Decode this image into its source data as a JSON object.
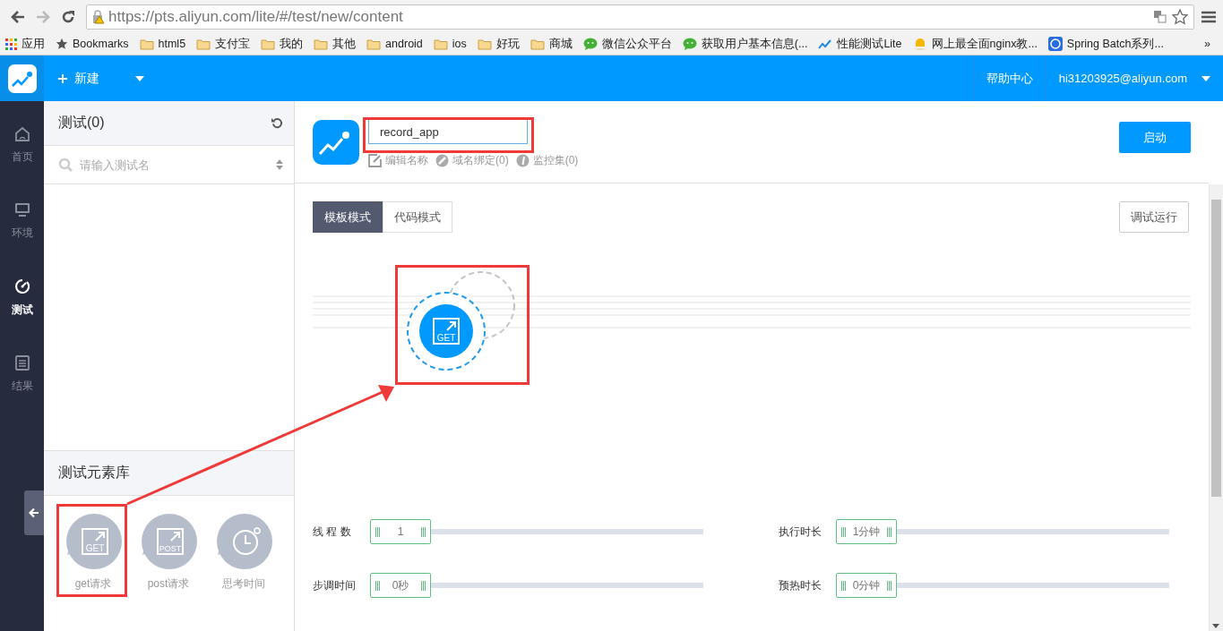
{
  "browser": {
    "url": "https://pts.aliyun.com/lite/#/test/new/content",
    "bookmarks": [
      {
        "kind": "apps",
        "label": "应用"
      },
      {
        "kind": "star",
        "label": "Bookmarks"
      },
      {
        "kind": "folder",
        "label": "html5"
      },
      {
        "kind": "folder",
        "label": "支付宝"
      },
      {
        "kind": "folder",
        "label": "我的"
      },
      {
        "kind": "folder",
        "label": "其他"
      },
      {
        "kind": "folder",
        "label": "android"
      },
      {
        "kind": "folder",
        "label": "ios"
      },
      {
        "kind": "folder",
        "label": "好玩"
      },
      {
        "kind": "folder",
        "label": "商城"
      },
      {
        "kind": "chat",
        "label": "微信公众平台"
      },
      {
        "kind": "chat",
        "label": "获取用户基本信息(..."
      },
      {
        "kind": "chart",
        "label": "性能测试Lite"
      },
      {
        "kind": "bell",
        "label": "网上最全面nginx教..."
      },
      {
        "kind": "site",
        "label": "Spring Batch系列..."
      }
    ],
    "overflow": "»"
  },
  "header": {
    "new_label": "新建",
    "help": "帮助中心",
    "user": "hi31203925@aliyun.com"
  },
  "nav": [
    {
      "kind": "home",
      "label": "首页",
      "selected": false
    },
    {
      "kind": "monitor",
      "label": "环境",
      "selected": false
    },
    {
      "kind": "gauge",
      "label": "测试",
      "selected": true
    },
    {
      "kind": "doc",
      "label": "结果",
      "selected": false
    }
  ],
  "sidebar": {
    "title": "测试(0)",
    "search_placeholder": "请输入测试名",
    "library_title": "测试元素库",
    "elements": [
      {
        "kind": "get",
        "icon_text": "GET",
        "label": "get请求"
      },
      {
        "kind": "post",
        "icon_text": "POST",
        "label": "post请求"
      },
      {
        "kind": "timer",
        "label": "思考时间"
      }
    ]
  },
  "test": {
    "name": "record_app",
    "links": [
      {
        "kind": "edit",
        "label": "编辑名称"
      },
      {
        "kind": "link",
        "label": "域名绑定(0)"
      },
      {
        "kind": "gauge",
        "label": "监控集(0)"
      }
    ],
    "start": "启动",
    "modes": [
      {
        "label": "模板模式",
        "selected": true
      },
      {
        "label": "代码模式",
        "selected": false
      }
    ],
    "debug": "调试运行",
    "canvas_node": {
      "kind": "get",
      "icon_text": "GET"
    },
    "settings": [
      {
        "label": "线 程 数",
        "value": "1"
      },
      {
        "label": "执行时长",
        "value": "1分钟"
      },
      {
        "label": "步调时间",
        "value": "0秒"
      },
      {
        "label": "预热时长",
        "value": "0分钟"
      }
    ]
  }
}
